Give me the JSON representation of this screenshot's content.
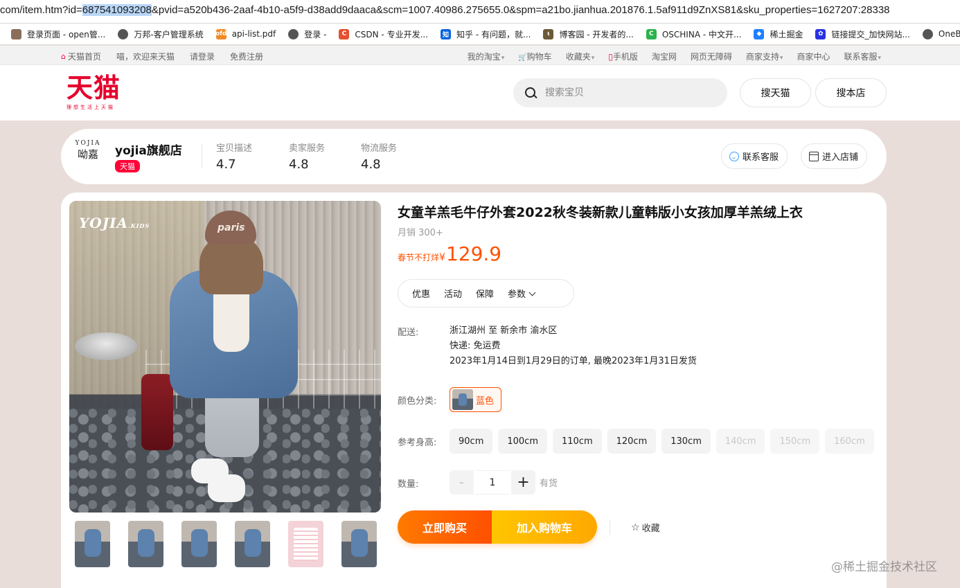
{
  "browser": {
    "url_prefix": "com/item.htm?id=",
    "url_selected": "687541093208",
    "url_rest": "&pvid=a520b436-2aaf-4b10-a5f9-d38add9daaca&scm=1007.40986.275655.0&spm=a21bo.jianhua.201876.1.5af911d9ZnXS81&sku_properties=1627207:28338",
    "bookmarks": [
      {
        "label": "登录页面 - open管...",
        "icon": "avatar-icon",
        "color": "#8a6d5a",
        "glyph": ""
      },
      {
        "label": "万邦-客户管理系统",
        "icon": "globe-icon",
        "color": "#555555",
        "glyph": ""
      },
      {
        "label": "api-list.pdf",
        "icon": "ofd-icon",
        "color": "#f08a24",
        "glyph": "ofd"
      },
      {
        "label": "登录 -",
        "icon": "globe-icon",
        "color": "#555555",
        "glyph": ""
      },
      {
        "label": "CSDN - 专业开发...",
        "icon": "csdn-icon",
        "color": "#e6502e",
        "glyph": "C"
      },
      {
        "label": "知乎 - 有问题，就...",
        "icon": "zhihu-icon",
        "color": "#0a66e0",
        "glyph": "知"
      },
      {
        "label": "博客园 - 开发者的...",
        "icon": "cnblogs-icon",
        "color": "#6a5a3a",
        "glyph": "ι"
      },
      {
        "label": "OSCHINA - 中文开...",
        "icon": "oschina-icon",
        "color": "#2bb24c",
        "glyph": "C"
      },
      {
        "label": "稀土掘金",
        "icon": "juejin-icon",
        "color": "#1e80ff",
        "glyph": "◆"
      },
      {
        "label": "链接提交_加快网站...",
        "icon": "baidu-icon",
        "color": "#2932e1",
        "glyph": "✿"
      },
      {
        "label": "OneBou",
        "icon": "globe-icon",
        "color": "#555555",
        "glyph": ""
      }
    ]
  },
  "sitenav": {
    "left": [
      "天猫首页",
      "喵，欢迎来天猫",
      "请登录",
      "免费注册"
    ],
    "right": [
      {
        "label": "我的淘宝",
        "caret": true
      },
      {
        "label": "购物车",
        "caret": false
      },
      {
        "label": "收藏夹",
        "caret": true
      },
      {
        "label": "手机版",
        "caret": false
      },
      {
        "label": "淘宝网",
        "caret": false
      },
      {
        "label": "网页无障碍",
        "caret": false
      },
      {
        "label": "商家支持",
        "caret": true
      },
      {
        "label": "商家中心",
        "caret": false
      },
      {
        "label": "联系客服",
        "caret": true
      }
    ]
  },
  "header": {
    "logo_text": "天猫",
    "logo_slogan": "理想生活上天猫",
    "search_placeholder": "搜索宝贝",
    "search_tmall": "搜天猫",
    "search_shop": "搜本店"
  },
  "shop": {
    "logo_en": "YOJIA",
    "logo_cn": "呦嘉",
    "name": "yojia旗舰店",
    "tag": "天猫",
    "scores": [
      {
        "label": "宝贝描述",
        "value": "4.7"
      },
      {
        "label": "卖家服务",
        "value": "4.8"
      },
      {
        "label": "物流服务",
        "value": "4.8"
      }
    ],
    "contact": "联系客服",
    "enter": "进入店铺"
  },
  "product": {
    "image_brand": "YOJIA",
    "image_brand_suffix": "KIDS",
    "cap_text": "paris",
    "title": "女童羊羔毛牛仔外套2022秋冬装新款儿童韩版小女孩加厚羊羔绒上衣",
    "sales": "月销 300+",
    "price_promo": "春节不打烊",
    "price_currency": "¥",
    "price": "129.9",
    "tabs": [
      "优惠",
      "活动",
      "保障",
      "参数"
    ],
    "shipping_label": "配送:",
    "shipping_route": "浙江湖州 至 新余市 渝水区",
    "shipping_fee": "快递: 免运费",
    "shipping_note": "2023年1月14日到1月29日的订单, 最晚2023年1月31日发货",
    "color_label": "颜色分类:",
    "color_selected": "蓝色",
    "size_label": "参考身高:",
    "sizes": [
      {
        "label": "90cm",
        "available": true
      },
      {
        "label": "100cm",
        "available": true
      },
      {
        "label": "110cm",
        "available": true
      },
      {
        "label": "120cm",
        "available": true
      },
      {
        "label": "130cm",
        "available": true
      },
      {
        "label": "140cm",
        "available": false
      },
      {
        "label": "150cm",
        "available": false
      },
      {
        "label": "160cm",
        "available": false
      }
    ],
    "qty_label": "数量:",
    "qty_minus": "-",
    "qty_value": "1",
    "qty_plus": "+",
    "stock": "有货",
    "buy_now": "立即购买",
    "add_cart": "加入购物车",
    "favorite": "收藏"
  },
  "watermark": "@稀土掘金技术社区",
  "colors": {
    "tmall_red": "#ff0036",
    "price_orange": "#ff5000",
    "buy_orange": "#ff7a00",
    "cart_yellow": "#ffc500"
  }
}
